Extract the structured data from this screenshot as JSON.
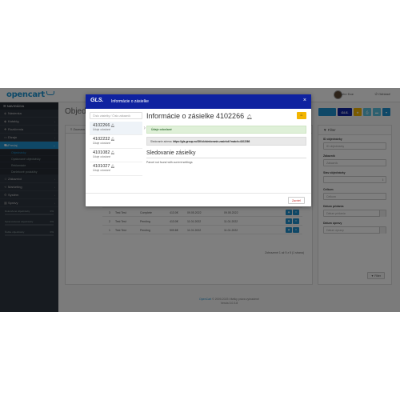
{
  "header": {
    "logo": "opencart",
    "user": "John Doe",
    "logout": "Odhlásiť"
  },
  "sidebar": {
    "heading": "NAVIGÁCIA",
    "items": [
      {
        "label": "Nástenka",
        "icon": "dashboard-icon"
      },
      {
        "label": "Katalóg",
        "icon": "tag-icon"
      },
      {
        "label": "Rozšírenia",
        "icon": "puzzle-icon"
      },
      {
        "label": "Dizajn",
        "icon": "monitor-icon"
      },
      {
        "label": "Predaj",
        "icon": "cart-icon"
      }
    ],
    "subitems": [
      "Objednávky",
      "Opakované objednávky",
      "Reklamácie",
      "Darčekové poukážky"
    ],
    "items2": [
      {
        "label": "Zákazníci",
        "icon": "user-icon"
      },
      {
        "label": "Marketing",
        "icon": "share-icon"
      },
      {
        "label": "Systém",
        "icon": "gear-icon"
      },
      {
        "label": "Správy",
        "icon": "bar-chart-icon"
      }
    ],
    "progress": [
      {
        "label": "Dokončené objednávky",
        "value": "0%"
      },
      {
        "label": "Spracovávané objednávky",
        "value": "0%"
      },
      {
        "label": "Ďalšie objednávky",
        "value": "0%"
      }
    ]
  },
  "content": {
    "title": "Objednávky",
    "list_head": "Zoznam objednávok",
    "gls_btn": "GLS.",
    "rows": [
      {
        "id": "4",
        "name": "Test Test",
        "status": "Pending",
        "total": "0.0000€",
        "added": "08.11.2022",
        "modified": "10.11.2022"
      },
      {
        "id": "3",
        "name": "Test Test",
        "status": "Pending",
        "total": "70.4€",
        "added": "09.05.2022",
        "modified": "09.11.2022"
      },
      {
        "id": "3",
        "name": "Test Test",
        "status": "Complete",
        "total": "413.0€",
        "added": "09.05.2022",
        "modified": "09.05.2022"
      },
      {
        "id": "2",
        "name": "Test Test",
        "status": "Pending",
        "total": "413.0€",
        "added": "11.01.2022",
        "modified": "11.01.2022"
      },
      {
        "id": "1",
        "name": "Test Test",
        "status": "Pending",
        "total": "509.6€",
        "added": "11.01.2022",
        "modified": "11.01.2022"
      }
    ],
    "pager": "Zobrazené 1 až 5 z 5 (1 strana)"
  },
  "filter": {
    "title": "Filter",
    "fields": [
      {
        "label": "ID objednávky",
        "placeholder": "ID objednávky"
      },
      {
        "label": "Zákazník",
        "placeholder": "Zákazník"
      },
      {
        "label": "Stav objednávky",
        "placeholder": ""
      },
      {
        "label": "Celkom",
        "placeholder": "Celkom"
      },
      {
        "label": "Dátum pridania",
        "placeholder": "Dátum pridania"
      },
      {
        "label": "Dátum úpravy",
        "placeholder": "Dátum úpravy"
      }
    ],
    "button": "Filter"
  },
  "footer": {
    "brand": "OpenCart",
    "text": "© 2009-2023 Všetky práva vyhradené",
    "version": "Verzia 3.0.3.8"
  },
  "modal": {
    "title": "Informácie o zásielke",
    "gls_logo": "GLS.",
    "search_placeholder": "Číslo zásielky / Číslo zákazník",
    "parcels": [
      {
        "id": "4102266",
        "status": "Údaje odoslané"
      },
      {
        "id": "4102232",
        "status": "Údaje odoslané"
      },
      {
        "id": "4101082",
        "status": "Údaje odoslané"
      },
      {
        "id": "4101027",
        "status": "Údaje odoslané"
      }
    ],
    "detail_title": "Informácie o zásielke 4102266",
    "alert": "Údaje odoslané",
    "track_label": "Sledovanie adresa:",
    "track_url": "https://gls-group.eu/SK/sk/sledovanie-zasielok?match=4102266",
    "section_title": "Sledovanie zásielky",
    "section_text": "Parcel not found with current settings",
    "close": "Zavrieť"
  },
  "colors": {
    "primary": "#1e91cf",
    "gls_blue": "#0f22a0",
    "warning": "#f3b500"
  }
}
